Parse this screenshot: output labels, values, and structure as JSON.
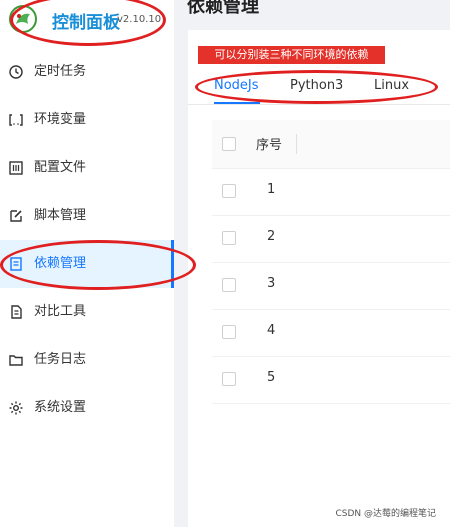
{
  "app": {
    "title": "控制面板",
    "version": "v2.10.10"
  },
  "page": {
    "title": "依赖管理"
  },
  "annotation": {
    "text": "可以分别装三种不同环境的依赖"
  },
  "sidebar": {
    "items": [
      {
        "label": "定时任务",
        "icon": "clock-icon"
      },
      {
        "label": "环境变量",
        "icon": "variable-icon"
      },
      {
        "label": "配置文件",
        "icon": "config-icon"
      },
      {
        "label": "脚本管理",
        "icon": "edit-icon"
      },
      {
        "label": "依赖管理",
        "icon": "dependency-icon",
        "active": true
      },
      {
        "label": "对比工具",
        "icon": "diff-icon"
      },
      {
        "label": "任务日志",
        "icon": "folder-icon"
      },
      {
        "label": "系统设置",
        "icon": "gear-icon"
      }
    ]
  },
  "tabs": [
    {
      "label": "NodeJs",
      "active": true
    },
    {
      "label": "Python3"
    },
    {
      "label": "Linux"
    }
  ],
  "table": {
    "header": "序号",
    "rows": [
      "1",
      "2",
      "3",
      "4",
      "5"
    ]
  },
  "footer": {
    "text": "CSDN @达莓的编程笔记"
  },
  "colors": {
    "accent": "#1677ff",
    "annotation": "#e4322b",
    "logo": "#1a8fd8"
  }
}
